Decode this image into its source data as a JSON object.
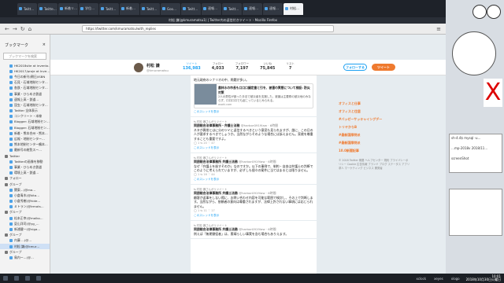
{
  "browser": {
    "tabs": [
      "Twitt…",
      "Twitte…",
      "新着リ…",
      "学位…",
      "Twitt…",
      "新着…",
      "Twitt…",
      "Goo…",
      "Twitt…",
      "速報…",
      "Twitt…",
      "速報…",
      "速報…",
      "村松…"
    ],
    "active_tab_index": 13,
    "window_title": "村松 謙(@kmuramatsu1) | Twitter内の返信付きツイート - Mozilla Firefox",
    "url": "https://twitter.com/kmuramatsu/with_replies"
  },
  "sidebar": {
    "title": "ブックマーク",
    "close": "×",
    "search_placeholder": "ブックマークを検索",
    "items": [
      {
        "label": "HK2018site at invento…",
        "folder": false,
        "sel": false
      },
      {
        "label": "HK2017/proje at Inve…",
        "folder": false,
        "sel": false
      },
      {
        "label": "今日の新刊(朝日/ISBN",
        "folder": false,
        "sel": false
      },
      {
        "label": "石見・石域地制センタ…",
        "folder": false,
        "sel": false
      },
      {
        "label": "各鉄・石域地制センタ…",
        "folder": false,
        "sel": false
      },
      {
        "label": "事業・ひらめき鉄道",
        "folder": false,
        "sel": false
      },
      {
        "label": "速報上高・鉄道…",
        "folder": false,
        "sel": false
      },
      {
        "label": "昆虫・石域地制センタ…",
        "folder": false,
        "sel": false
      },
      {
        "label": "Twitter 全体表示",
        "folder": false,
        "sel": false
      },
      {
        "label": "コンクリート・本線",
        "folder": false,
        "sel": false
      },
      {
        "label": "Blogger: 石域地制セン…",
        "folder": false,
        "sel": false
      },
      {
        "label": "Blogger: 石域地制セン…",
        "folder": false,
        "sel": false
      },
      {
        "label": "新着・熊本合州・熊本…",
        "folder": false,
        "sel": false
      },
      {
        "label": "広報・地制センター…",
        "folder": false,
        "sel": false
      },
      {
        "label": "熊本地制センター鶴本…",
        "folder": false,
        "sel": false
      },
      {
        "label": "最新号の総覧スー…",
        "folder": false,
        "sel": false
      },
      {
        "label": "Twitter",
        "folder": true,
        "sel": false
      },
      {
        "label": "Twitterの画像を移動",
        "folder": false,
        "sel": false
      },
      {
        "label": "事業・ひらめき鉄道",
        "folder": false,
        "sel": false
      },
      {
        "label": "環境上高・鉄道…",
        "folder": false,
        "sel": false
      },
      {
        "label": "フォロー",
        "folder": true,
        "sel": false
      },
      {
        "label": "グループ",
        "folder": true,
        "sel": false
      },
      {
        "label": "関東…(@ma…",
        "folder": false,
        "sel": false
      },
      {
        "label": "小倉青木(@kita…",
        "folder": false,
        "sel": false
      },
      {
        "label": "小倉秀樹(@hide…",
        "folder": false,
        "sel": false
      },
      {
        "label": "ミトラン(@trmots…",
        "folder": false,
        "sel": false
      },
      {
        "label": "グループ",
        "folder": true,
        "sel": false
      },
      {
        "label": "松本正幸(@malko…",
        "folder": false,
        "sel": false
      },
      {
        "label": "夏山洋司(@yg_…",
        "folder": false,
        "sel": false
      },
      {
        "label": "新浦健一(@niga…",
        "folder": false,
        "sel": false
      },
      {
        "label": "グループ",
        "folder": true,
        "sel": false
      },
      {
        "label": "内藤 …(@…",
        "folder": false,
        "sel": false
      },
      {
        "label": "村松 謙(@kmur…",
        "folder": false,
        "sel": true
      },
      {
        "label": "グループ",
        "folder": true,
        "sel": false
      },
      {
        "label": "鳥内ー…(@…",
        "folder": false,
        "sel": false
      }
    ]
  },
  "profile": {
    "name": "村松 謙",
    "handle": "@kmuramatsu",
    "stats": [
      {
        "label": "ツイート",
        "value": "136,983",
        "active": true
      },
      {
        "label": "フォロー",
        "value": "4,033",
        "active": false
      },
      {
        "label": "フォロワー",
        "value": "7,197",
        "active": false
      },
      {
        "label": "いいね",
        "value": "75,845",
        "active": false
      },
      {
        "label": "リスト",
        "value": "7",
        "active": false
      }
    ],
    "follow_button": "フォローする",
    "tweet_button": "ツイート"
  },
  "tweets": [
    {
      "rt": "",
      "name": "",
      "handle": "",
      "time": "",
      "text": "地元政府のシナリオの中、問題が多い。",
      "card_title": "農林水の市長も口口口議定書と引を、被害の実態について検証: 防災対策",
      "card_desc": "2人の男性が誤った手法で被災者を支援した。被害は主要県の被災地のみならず、口口口口でも起こっているとみられる。",
      "card_link": "asahi.com",
      "actions": "",
      "thread": "このスレッドを表示"
    },
    {
      "rt": "村松 謙さんがリツイート",
      "name": "同朋総合法律事務所・弁護士法務",
      "handle": "@harbor0919law · 6時間",
      "time": "",
      "text": "ネタが異常とはに分のツイに返信するべきという意見も見られますが、誰に、この日の人が要求するべきでしょうか。当然ながらそのような場合には訴えません。家裁を尊重することも重要ですよ。",
      "card_title": "",
      "card_desc": "",
      "card_link": "",
      "actions": "◯ 1   ⇆ 20   ♡ 47",
      "thread": "このスレッドを表示"
    },
    {
      "rt": "村松 謙さんがリツイート",
      "name": "同朋総合法律事務所 弁護士法務",
      "handle": "@harbor0919law · 6時間",
      "time": "",
      "text": "なぜ「弁護士を殺すそのか」なのですか。以下の事例で、制約・自由は弁護士の判断でこのように考えられていますが、必ずしも個々の案件に当てはまるとは限りません。",
      "card_title": "",
      "card_desc": "",
      "card_link": "",
      "actions": "◯ 1   ⇆ 16   ♡ 44",
      "thread": "このスレッドを表示"
    },
    {
      "rt": "村松 謙さんがリツイート",
      "name": "同朋総合法律事務所 弁護士法務",
      "handle": "@harbor0919law · 6時間",
      "time": "",
      "text": "顧客が返事をしない際に、お問い合わせ内容を可能な範囲で検討し、その上で判断します。当然ながら、依頼者の意向は尊重されますが、法律上許されない事項には応じられません。",
      "card_title": "",
      "card_desc": "",
      "card_link": "",
      "actions": "◯ 1   ⇆ 11   ♡ 17",
      "thread": "このスレッドを表示"
    },
    {
      "rt": "村松 謙さんがリツイート",
      "name": "同朋総合法律事務所 弁護士法務",
      "handle": "@harbor0919law · 6時間",
      "time": "",
      "text": "例えば「無期懲役者」は、素晴らしい事実を含む場合もありえます。",
      "card_title": "",
      "card_desc": "",
      "card_link": "",
      "actions": "",
      "thread": ""
    }
  ],
  "right_column": {
    "links": [
      "オフィスと仕事",
      "オフィスと住居",
      "#バッゼーサッキャイングデー",
      "トリヤからB",
      "#最新国際特派",
      "#最新国際特派",
      "10.0新聞記事"
    ],
    "footer": "© 2018 Twitter 概要 ヘルプセンター 規約 プライバシーポリシー Cookie 広告情報 ブランド ブログ ステータス アプリ 求人 マーケティング ビジネス 開発者"
  },
  "taskbar": {
    "items": [
      "xclock",
      "xeyes",
      "xlogo"
    ],
    "time": "10:01",
    "date": "2018年10月30日火曜日"
  },
  "desktop": {
    "term_lines": [
      "sh-4.4$ mysql -u…",
      "…mp-2018v 2018/11…",
      "screenShot"
    ]
  },
  "colors": {
    "twitter_blue": "#1da1f2",
    "twitter_orange": "#ef7a2f",
    "firefox_dark": "#1e2229"
  }
}
